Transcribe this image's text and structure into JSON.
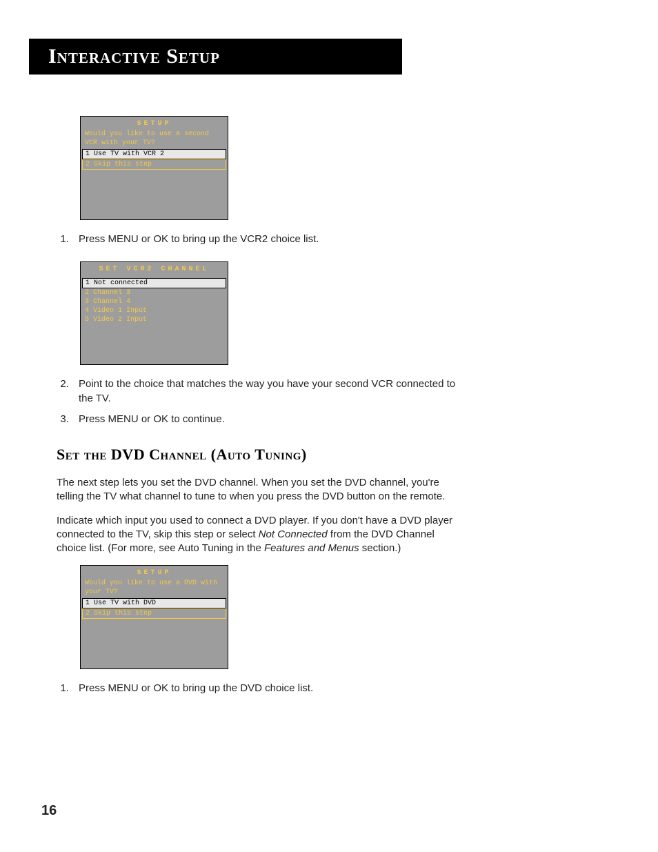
{
  "header": {
    "title": "Interactive Setup"
  },
  "osd1": {
    "title": "SETUP",
    "prompt": "Would you like to use a second VCR with your TV?",
    "opt1": "1 Use TV with VCR 2",
    "opt2": "2 Skip this step"
  },
  "step1": "Press MENU or OK to bring up the VCR2 choice list.",
  "osd2": {
    "title": "SET VCR2 CHANNEL",
    "opt1": "1 Not connected",
    "opt2": "2 Channel 3",
    "opt3": "3 Channel 4",
    "opt4": "4 Video 1 Input",
    "opt5": "5 Video 2 Input"
  },
  "step2": "Point to the choice that matches the way you have your second VCR connected to the TV.",
  "step3": "Press MENU or OK to continue.",
  "section": {
    "heading": "Set the DVD Channel (Auto Tuning)"
  },
  "para1a": "The next step lets you set the DVD channel. When you set the DVD channel, you're telling the TV what channel to tune to when you press the DVD button on the remote.",
  "para2a": "Indicate which input you used to connect a DVD player. If you don't have a DVD player connected to the TV, skip this step or select ",
  "para2b": "Not Connected",
  "para2c": " from the DVD Channel choice list. (For more, see Auto Tuning in the ",
  "para2d": "Features and Menus",
  "para2e": " section.)",
  "osd3": {
    "title": "SETUP",
    "prompt": "Would you like to use a DVD with your TV?",
    "opt1": "1 Use TV with DVD",
    "opt2": "2 Skip this step"
  },
  "step4": "Press MENU or OK to bring up the DVD choice list.",
  "pageNumber": "16"
}
